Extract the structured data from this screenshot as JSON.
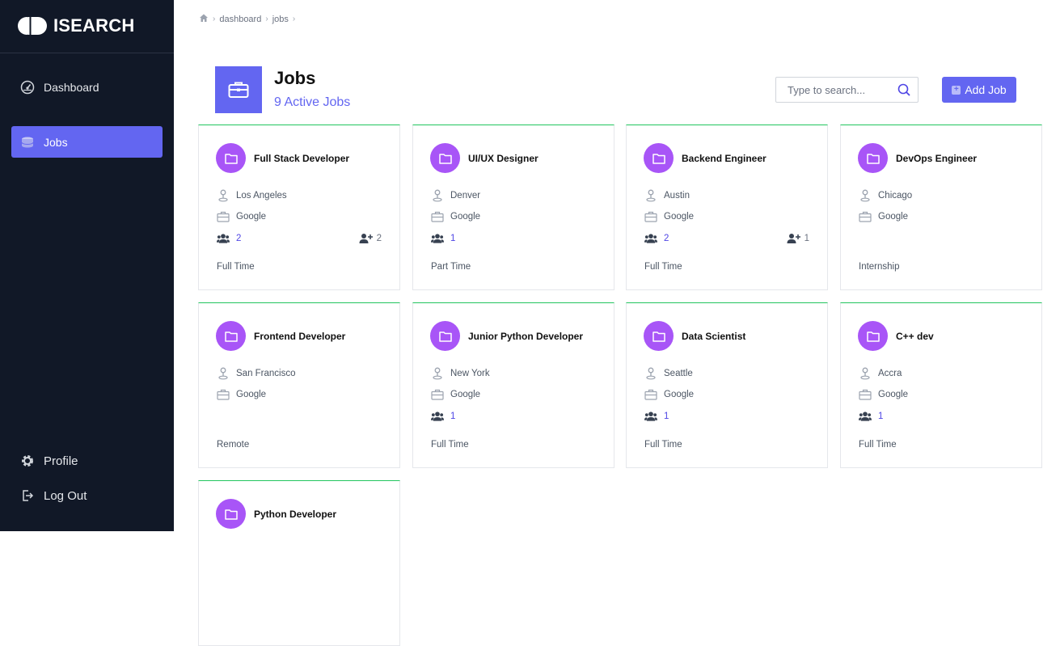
{
  "app": {
    "name": "ISEARCH"
  },
  "sidebar": {
    "items": [
      {
        "label": "Dashboard",
        "icon": "dashboard-icon"
      },
      {
        "label": "Jobs",
        "icon": "jobs-icon",
        "active": true
      }
    ],
    "bottom": [
      {
        "label": "Profile",
        "icon": "gear-icon"
      },
      {
        "label": "Log Out",
        "icon": "logout-icon"
      }
    ]
  },
  "breadcrumb": [
    "dashboard",
    "jobs"
  ],
  "header": {
    "title": "Jobs",
    "subtitle": "9 Active Jobs"
  },
  "search": {
    "placeholder": "Type to search..."
  },
  "add_button": {
    "label": "Add Job"
  },
  "colors": {
    "accent": "#6366f1",
    "avatar": "#a855f7",
    "sidebar": "#111827",
    "card_top": "#22c55e"
  },
  "jobs": [
    {
      "title": "Full Stack Developer",
      "location": "Los Angeles",
      "company": "Google",
      "applicants": "2",
      "hires": "2",
      "type": "Full Time"
    },
    {
      "title": "UI/UX Designer",
      "location": "Denver",
      "company": "Google",
      "applicants": "1",
      "hires": "",
      "type": "Part Time"
    },
    {
      "title": "Backend Engineer",
      "location": "Austin",
      "company": "Google",
      "applicants": "2",
      "hires": "1",
      "type": "Full Time"
    },
    {
      "title": "DevOps Engineer",
      "location": "Chicago",
      "company": "Google",
      "applicants": "",
      "hires": "",
      "type": "Internship"
    },
    {
      "title": "Frontend Developer",
      "location": "San Francisco",
      "company": "Google",
      "applicants": "",
      "hires": "",
      "type": "Remote"
    },
    {
      "title": "Junior Python Developer",
      "location": "New York",
      "company": "Google",
      "applicants": "1",
      "hires": "",
      "type": "Full Time"
    },
    {
      "title": "Data Scientist",
      "location": "Seattle",
      "company": "Google",
      "applicants": "1",
      "hires": "",
      "type": "Full Time"
    },
    {
      "title": "C++ dev",
      "location": "Accra",
      "company": "Google",
      "applicants": "1",
      "hires": "",
      "type": "Full Time"
    },
    {
      "title": "Python Developer",
      "location": "",
      "company": "",
      "applicants": "",
      "hires": "",
      "type": ""
    }
  ]
}
